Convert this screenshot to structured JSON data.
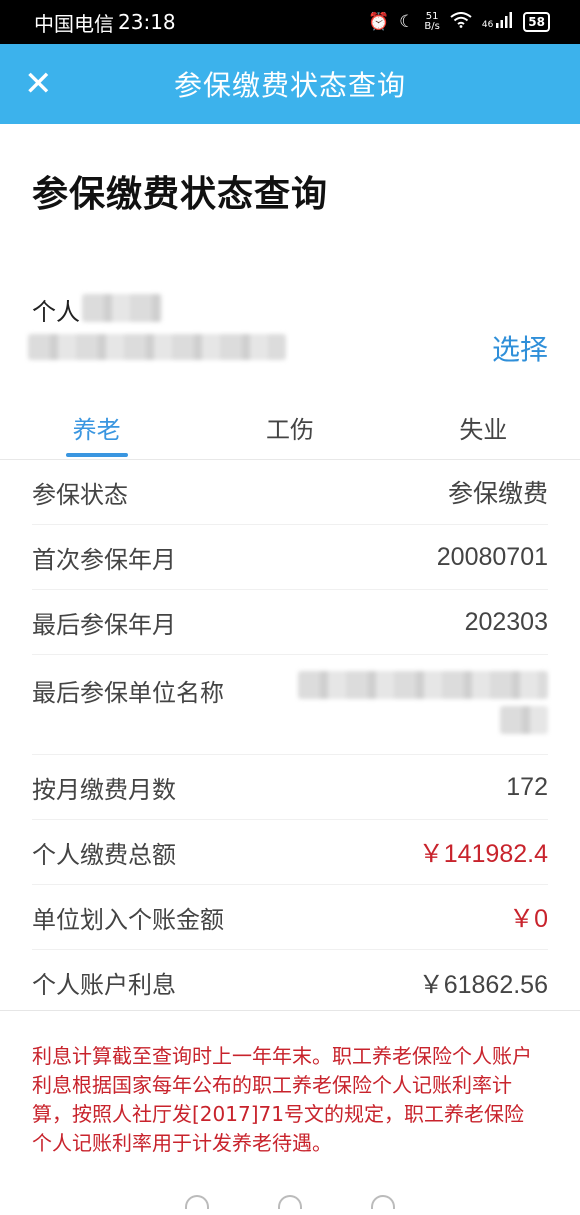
{
  "status_bar": {
    "carrier": "中国电信",
    "time": "23:18",
    "net_speed_value": "51",
    "net_speed_unit": "B/s",
    "network": "46",
    "battery": "58",
    "icons": [
      "alarm-icon",
      "moon-icon",
      "wifi-icon",
      "signal-icon",
      "battery-icon"
    ]
  },
  "title_bar": {
    "title": "参保缴费状态查询",
    "close_icon": "close-icon"
  },
  "page": {
    "heading": "参保缴费状态查询",
    "id_label": "个人",
    "select_button": "选择"
  },
  "tabs": [
    {
      "label": "养老",
      "active": true
    },
    {
      "label": "工伤",
      "active": false
    },
    {
      "label": "失业",
      "active": false
    }
  ],
  "rows": [
    {
      "label": "参保状态",
      "value": "参保缴费"
    },
    {
      "label": "首次参保年月",
      "value": "20080701"
    },
    {
      "label": "最后参保年月",
      "value": "202303"
    },
    {
      "label": "最后参保单位名称",
      "value": ""
    },
    {
      "label": "按月缴费月数",
      "value": "172"
    },
    {
      "label": "个人缴费总额",
      "value": "￥141982.4"
    },
    {
      "label": "单位划入个账金额",
      "value": "￥0"
    },
    {
      "label": "个人账户利息",
      "value": "￥61862.56"
    }
  ],
  "colors": {
    "title_bar": "#3cb2ec",
    "accent": "#3a96e0",
    "warning": "#c8232c"
  },
  "note": "利息计算截至查询时上一年年末。职工养老保险个人账户利息根据国家每年公布的职工养老保险个人记账利率计算，按照人社厅发[2017]71号文的规定，职工养老保险个人记账利率用于计发养老待遇。"
}
